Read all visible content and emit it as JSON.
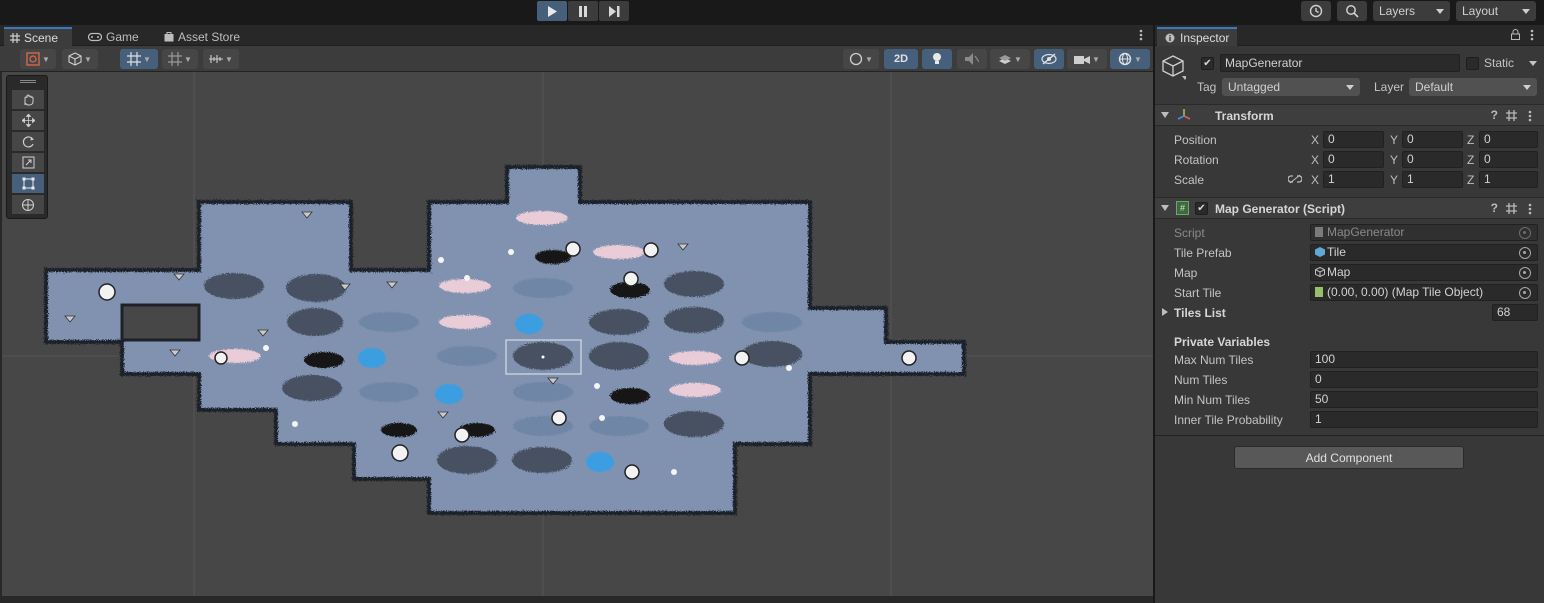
{
  "playbar": {
    "play_icon": "play-icon",
    "pause_icon": "pause-icon",
    "step_icon": "step-icon"
  },
  "topright": {
    "layers_label": "Layers",
    "layout_label": "Layout"
  },
  "scene_tabs": [
    {
      "label": "Scene",
      "icon": "grid-icon"
    },
    {
      "label": "Game",
      "icon": "gamepad-icon"
    },
    {
      "label": "Asset Store",
      "icon": "bag-icon"
    }
  ],
  "scene_toolbar": {
    "toggle_2d_label": "2D"
  },
  "inspector": {
    "tab_label": "Inspector",
    "object_name": "MapGenerator",
    "static_label": "Static",
    "tag_label": "Tag",
    "tag_value": "Untagged",
    "layer_label": "Layer",
    "layer_value": "Default",
    "transform": {
      "title": "Transform",
      "position_label": "Position",
      "rotation_label": "Rotation",
      "scale_label": "Scale",
      "position": {
        "x": "0",
        "y": "0",
        "z": "0"
      },
      "rotation": {
        "x": "0",
        "y": "0",
        "z": "0"
      },
      "scale": {
        "x": "1",
        "y": "1",
        "z": "1"
      },
      "axis_x": "X",
      "axis_y": "Y",
      "axis_z": "Z"
    },
    "script_component": {
      "title": "Map Generator (Script)",
      "script_label": "Script",
      "script_value": "MapGenerator",
      "tile_prefab_label": "Tile Prefab",
      "tile_prefab_value": "Tile",
      "map_label": "Map",
      "map_value": "Map",
      "start_tile_label": "Start Tile",
      "start_tile_value": "(0.00, 0.00) (Map Tile Object)",
      "tiles_list_label": "Tiles List",
      "tiles_list_count": "68",
      "private_vars_label": "Private Variables",
      "max_num_tiles_label": "Max Num Tiles",
      "max_num_tiles_value": "100",
      "num_tiles_label": "Num Tiles",
      "num_tiles_value": "0",
      "min_num_tiles_label": "Min Num Tiles",
      "min_num_tiles_value": "50",
      "inner_tile_prob_label": "Inner Tile Probability",
      "inner_tile_prob_value": "1"
    },
    "add_component_label": "Add Component"
  },
  "colors": {
    "accent": "#3a79bb",
    "map_floor": "#8092b0",
    "map_border": "#1f2129",
    "viewport_bg": "#474747"
  }
}
